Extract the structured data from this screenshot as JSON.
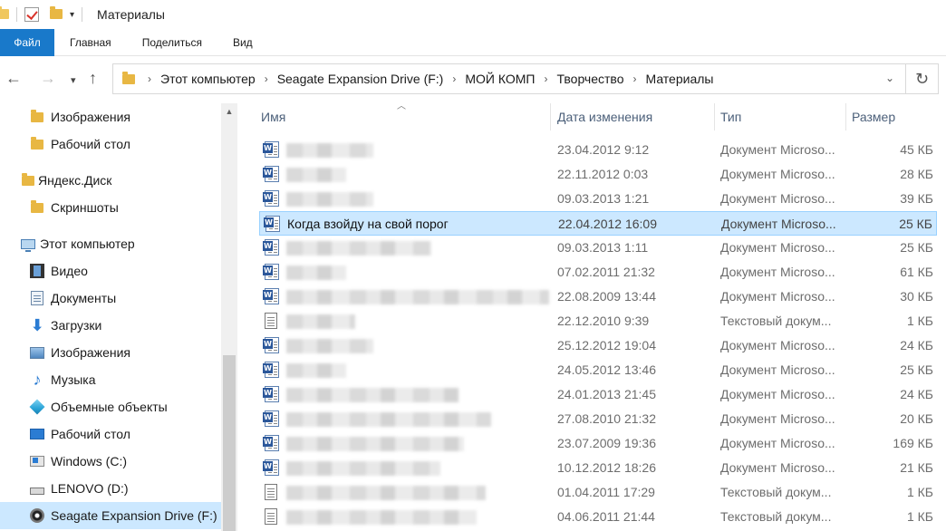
{
  "window": {
    "title": "Материалы"
  },
  "ribbon": {
    "tabs": [
      "Файл",
      "Главная",
      "Поделиться",
      "Вид"
    ]
  },
  "address": {
    "crumbs": [
      "Этот компьютер",
      "Seagate Expansion Drive (F:)",
      "МОЙ КОМП",
      "Творчество",
      "Материалы"
    ]
  },
  "nav": {
    "items": [
      {
        "label": "Изображения",
        "icon": "folder-icon"
      },
      {
        "label": "Рабочий стол",
        "icon": "folder-icon"
      },
      {
        "label": "Яндекс.Диск",
        "icon": "yandex-disk-icon"
      },
      {
        "label": "Скриншоты",
        "icon": "folder-icon"
      },
      {
        "label": "Этот компьютер",
        "icon": "computer-icon"
      },
      {
        "label": "Видео",
        "icon": "video-icon"
      },
      {
        "label": "Документы",
        "icon": "documents-icon"
      },
      {
        "label": "Загрузки",
        "icon": "downloads-icon"
      },
      {
        "label": "Изображения",
        "icon": "pictures-icon"
      },
      {
        "label": "Музыка",
        "icon": "music-icon"
      },
      {
        "label": "Объемные объекты",
        "icon": "3d-objects-icon"
      },
      {
        "label": "Рабочий стол",
        "icon": "desktop-icon"
      },
      {
        "label": "Windows (C:)",
        "icon": "windows-drive-icon"
      },
      {
        "label": "LENOVO (D:)",
        "icon": "drive-icon"
      },
      {
        "label": "Seagate Expansion Drive (F:)",
        "icon": "seagate-drive-icon"
      }
    ]
  },
  "columns": {
    "name": "Имя",
    "date": "Дата изменения",
    "type": "Тип",
    "size": "Размер"
  },
  "files": [
    {
      "name": "",
      "date": "23.04.2012 9:12",
      "type": "Документ Microso...",
      "size": "45 КБ",
      "icon": "word"
    },
    {
      "name": "",
      "date": "22.11.2012 0:03",
      "type": "Документ Microso...",
      "size": "28 КБ",
      "icon": "word"
    },
    {
      "name": "",
      "date": "09.03.2013 1:21",
      "type": "Документ Microso...",
      "size": "39 КБ",
      "icon": "word"
    },
    {
      "name": "Когда взойду на свой порог",
      "date": "22.04.2012 16:09",
      "type": "Документ Microso...",
      "size": "25 КБ",
      "icon": "word"
    },
    {
      "name": "",
      "date": "09.03.2013 1:11",
      "type": "Документ Microso...",
      "size": "25 КБ",
      "icon": "word"
    },
    {
      "name": "",
      "date": "07.02.2011 21:32",
      "type": "Документ Microso...",
      "size": "61 КБ",
      "icon": "word"
    },
    {
      "name": "",
      "date": "22.08.2009 13:44",
      "type": "Документ Microso...",
      "size": "30 КБ",
      "icon": "word"
    },
    {
      "name": "",
      "date": "22.12.2010 9:39",
      "type": "Текстовый докум...",
      "size": "1 КБ",
      "icon": "text"
    },
    {
      "name": "",
      "date": "25.12.2012 19:04",
      "type": "Документ Microso...",
      "size": "24 КБ",
      "icon": "word"
    },
    {
      "name": "",
      "date": "24.05.2012 13:46",
      "type": "Документ Microso...",
      "size": "25 КБ",
      "icon": "word"
    },
    {
      "name": "",
      "date": "24.01.2013 21:45",
      "type": "Документ Microso...",
      "size": "24 КБ",
      "icon": "word"
    },
    {
      "name": "",
      "date": "27.08.2010 21:32",
      "type": "Документ Microso...",
      "size": "20 КБ",
      "icon": "word"
    },
    {
      "name": "",
      "date": "23.07.2009 19:36",
      "type": "Документ Microso...",
      "size": "169 КБ",
      "icon": "word"
    },
    {
      "name": "",
      "date": "10.12.2012 18:26",
      "type": "Документ Microso...",
      "size": "21 КБ",
      "icon": "word"
    },
    {
      "name": "",
      "date": "01.04.2011 17:29",
      "type": "Текстовый докум...",
      "size": "1 КБ",
      "icon": "text"
    },
    {
      "name": "",
      "date": "04.06.2011 21:44",
      "type": "Текстовый докум...",
      "size": "1 КБ",
      "icon": "text"
    }
  ]
}
